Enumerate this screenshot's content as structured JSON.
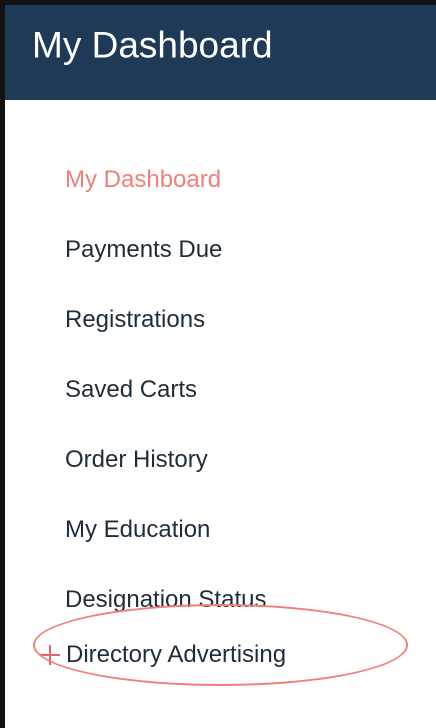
{
  "header": {
    "title": "My Dashboard"
  },
  "nav": {
    "items": [
      {
        "label": "My Dashboard",
        "active": true
      },
      {
        "label": "Payments Due",
        "active": false
      },
      {
        "label": "Registrations",
        "active": false
      },
      {
        "label": "Saved Carts",
        "active": false
      },
      {
        "label": "Order History",
        "active": false
      },
      {
        "label": "My Education",
        "active": false
      },
      {
        "label": "Designation Status",
        "active": false
      },
      {
        "label": "Directory Advertising",
        "active": false,
        "icon": "plus-icon",
        "highlighted": true
      }
    ]
  },
  "colors": {
    "header_bg": "#1f3a56",
    "header_text": "#ffffff",
    "active_link": "#ef7f78",
    "link_text": "#1f2d3a",
    "highlight": "#ef7f78",
    "border": "#111111"
  }
}
